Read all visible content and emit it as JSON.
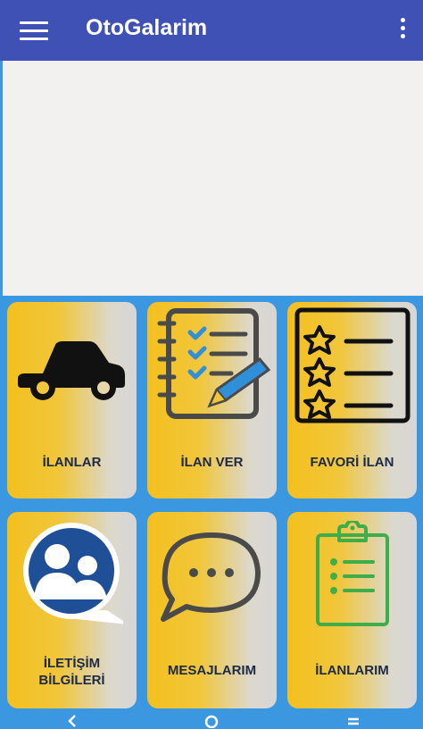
{
  "appbar": {
    "title": "OtoGalarim",
    "menu_icon": "menu-icon",
    "more_icon": "more-vert-icon"
  },
  "tiles": [
    {
      "label": "İLANLAR",
      "icon": "car-icon"
    },
    {
      "label": "İLAN VER",
      "icon": "notebook-checklist-pencil-icon"
    },
    {
      "label": "FAVORİ İLAN",
      "icon": "star-list-icon"
    },
    {
      "label": "İLETİŞİM\nBİLGİLERİ",
      "line1": "İLETİŞİM",
      "line2": "BİLGİLERİ",
      "icon": "contacts-icon"
    },
    {
      "label": "MESAJLARIM",
      "icon": "chat-bubble-icon"
    },
    {
      "label": "İLANLARIM",
      "icon": "clipboard-list-icon"
    }
  ],
  "colors": {
    "appbar": "#3f51b5",
    "background": "#3a97e0",
    "tile_gradient_start": "#f4c01f",
    "tile_gradient_end": "#d6d6d6"
  },
  "bottom_nav": [
    {
      "icon": "back-icon"
    },
    {
      "icon": "home-icon"
    },
    {
      "icon": "recents-icon"
    }
  ]
}
